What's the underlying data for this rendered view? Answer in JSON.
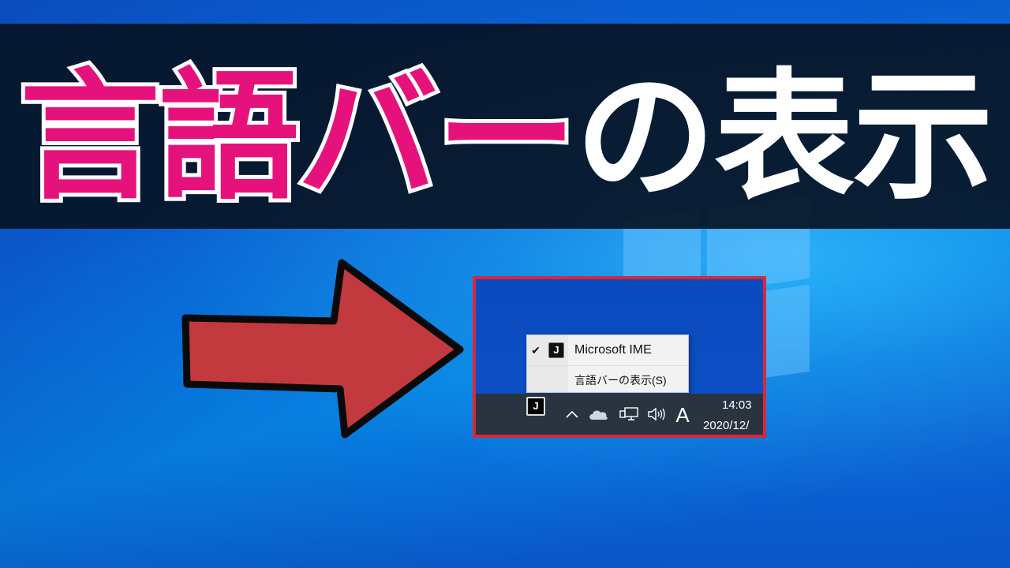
{
  "title": {
    "pink_part": "言語バー",
    "white_part": "の表示"
  },
  "context_menu": {
    "items": [
      {
        "label": "Microsoft IME",
        "checked": true,
        "icon": "ime-j-icon"
      },
      {
        "label": "言語バーの表示(S)",
        "checked": false
      }
    ],
    "ime_glyph": "J",
    "check_glyph": "✔"
  },
  "taskbar": {
    "ime_glyph": "J",
    "caret_glyph": "^",
    "input_mode": "A",
    "time": "14:03",
    "date": "2020/12/"
  },
  "colors": {
    "title_pink": "#e6127c",
    "highlight_border": "#d8283a",
    "arrow_fill": "#c23a3e"
  },
  "icons": [
    "ime-j-icon",
    "show-hidden-icons-caret-icon",
    "onedrive-cloud-icon",
    "network-icon",
    "volume-icon",
    "arrow-icon"
  ]
}
